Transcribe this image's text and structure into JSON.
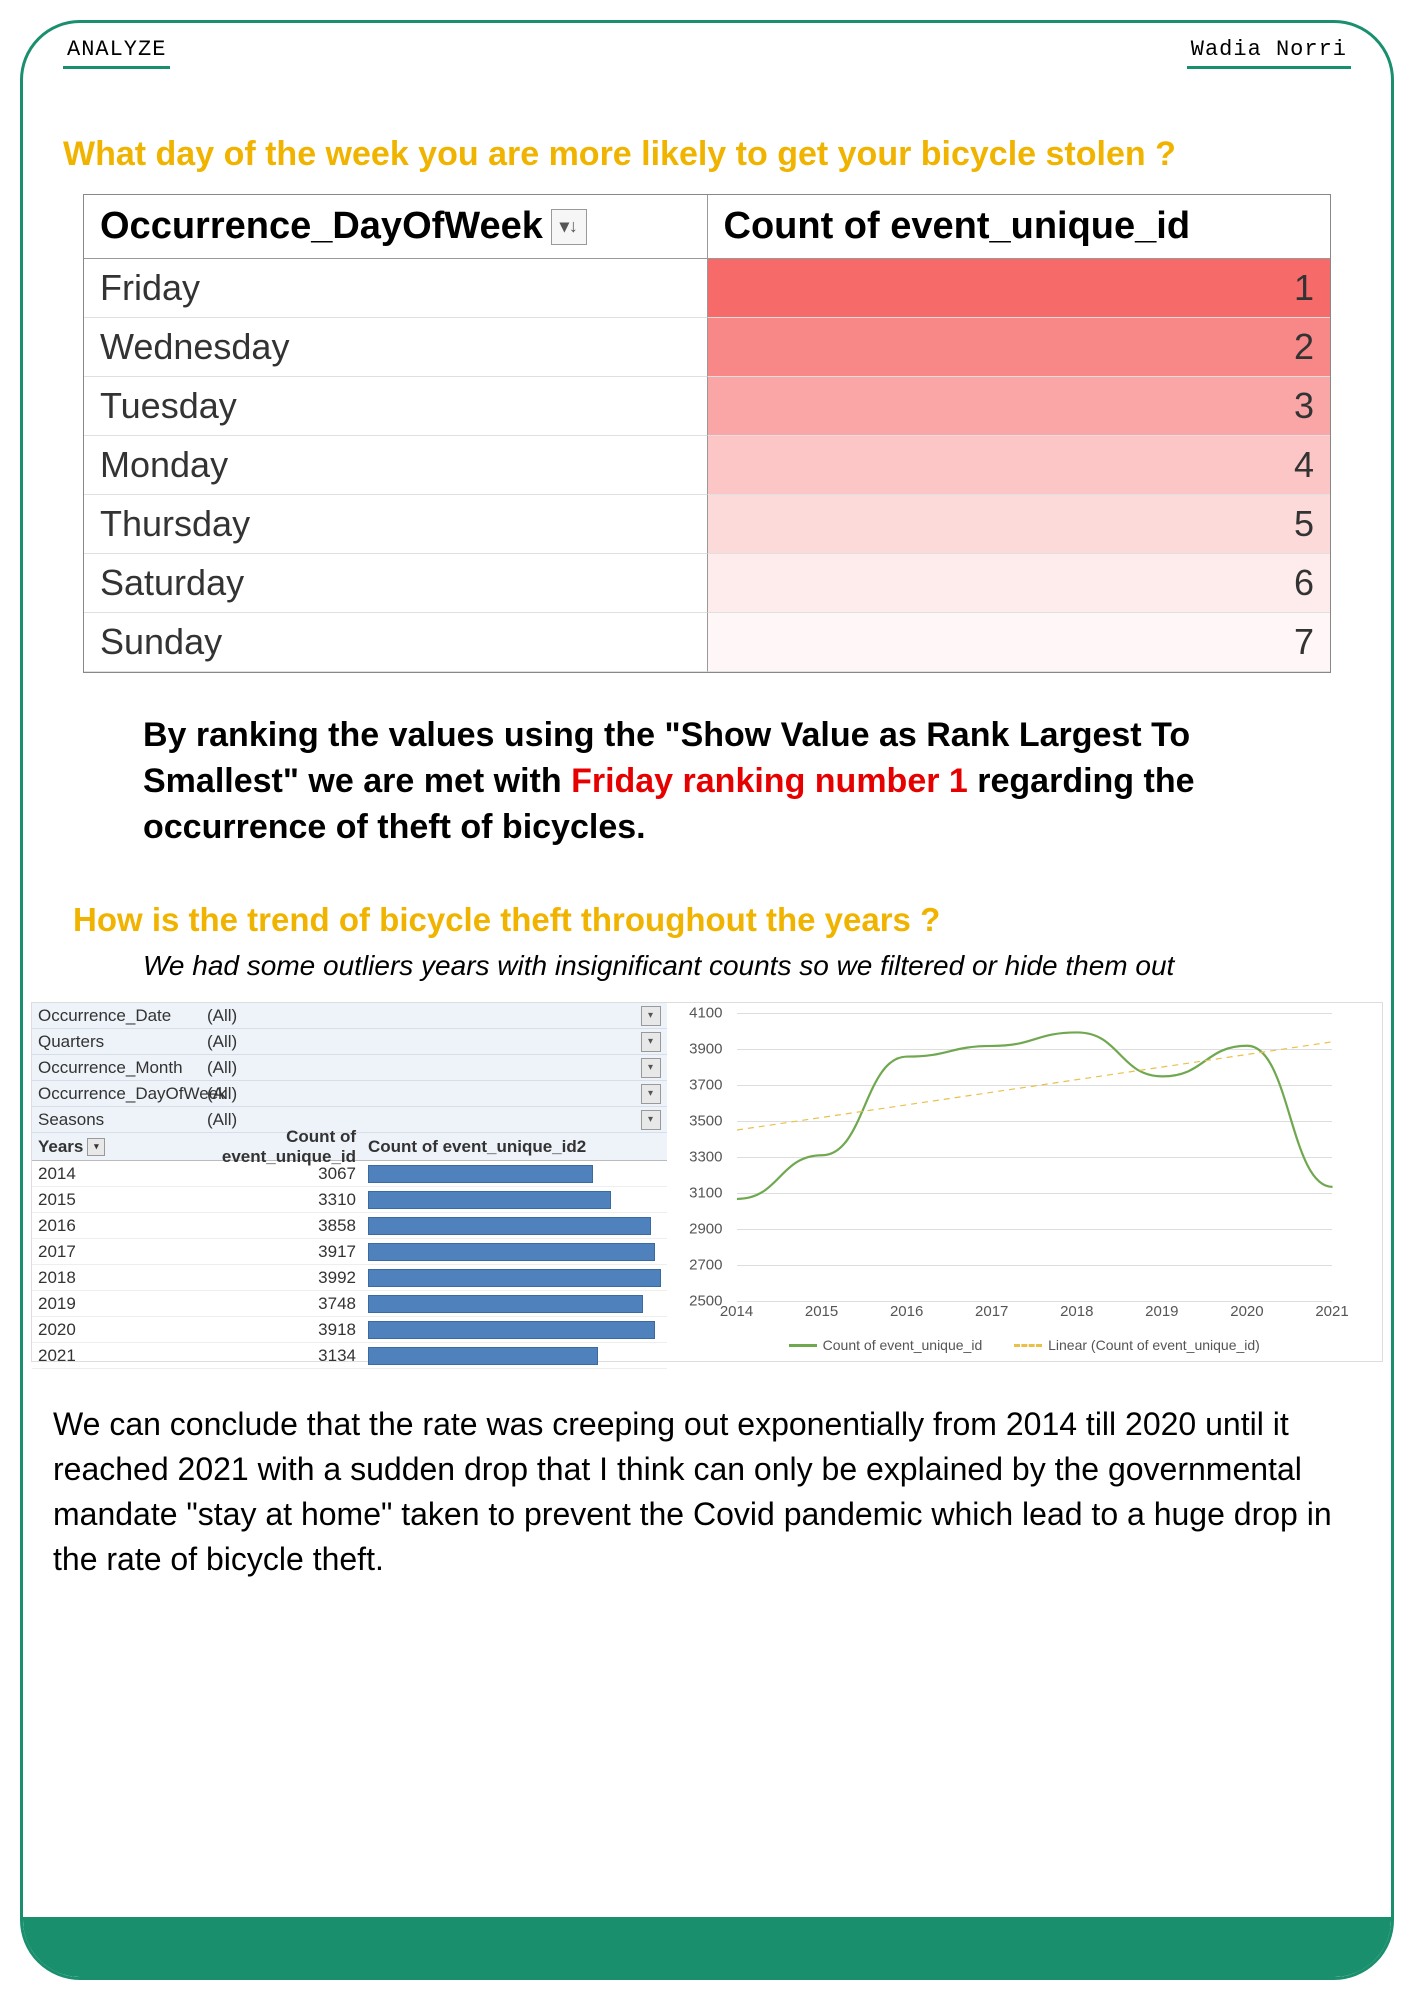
{
  "header": {
    "left": "ANALYZE",
    "right": "Wadia Norri"
  },
  "question1": "What day of the week you are more likely to get your bicycle stolen ?",
  "dow_table": {
    "col_a": "Occurrence_DayOfWeek",
    "col_b": "Count of event_unique_id",
    "rows": [
      {
        "day": "Friday",
        "rank": 1,
        "shade": "#f76a6a"
      },
      {
        "day": "Wednesday",
        "rank": 2,
        "shade": "#f88888"
      },
      {
        "day": "Tuesday",
        "rank": 3,
        "shade": "#faa6a6"
      },
      {
        "day": "Monday",
        "rank": 4,
        "shade": "#fcc6c6"
      },
      {
        "day": "Thursday",
        "rank": 5,
        "shade": "#fddada"
      },
      {
        "day": "Saturday",
        "rank": 6,
        "shade": "#feecec"
      },
      {
        "day": "Sunday",
        "rank": 7,
        "shade": "#fff7f7"
      }
    ]
  },
  "explain1": {
    "pre": "By ranking the values using the \"Show Value as Rank Largest To Smallest\" we  are met with ",
    "red": "Friday ranking number 1",
    "post": " regarding the occurrence of theft of bicycles."
  },
  "question2": "How is the trend of bicycle theft throughout the years ?",
  "note2": "We had some outliers years with insignificant counts so we filtered or hide them out",
  "filters": [
    {
      "name": "Occurrence_Date",
      "value": "(All)"
    },
    {
      "name": "Quarters",
      "value": "(All)"
    },
    {
      "name": "Occurrence_Month",
      "value": "(All)"
    },
    {
      "name": "Occurrence_DayOfWeek",
      "value": "(All)"
    },
    {
      "name": "Seasons",
      "value": "(All)"
    }
  ],
  "year_table": {
    "hdr_years": "Years",
    "hdr_count": "Count of event_unique_id",
    "hdr_count2": "Count of event_unique_id2",
    "rows": [
      {
        "year": "2014",
        "count": 3067
      },
      {
        "year": "2015",
        "count": 3310
      },
      {
        "year": "2016",
        "count": 3858
      },
      {
        "year": "2017",
        "count": 3917
      },
      {
        "year": "2018",
        "count": 3992
      },
      {
        "year": "2019",
        "count": 3748
      },
      {
        "year": "2020",
        "count": 3918
      },
      {
        "year": "2021",
        "count": 3134
      }
    ]
  },
  "chart_data": {
    "type": "line",
    "x": [
      "2014",
      "2015",
      "2016",
      "2017",
      "2018",
      "2019",
      "2020",
      "2021"
    ],
    "series": [
      {
        "name": "Count of event_unique_id",
        "values": [
          3067,
          3310,
          3858,
          3917,
          3992,
          3748,
          3918,
          3134
        ],
        "color": "#6fa84f",
        "style": "solid"
      },
      {
        "name": "Linear (Count of event_unique_id)",
        "values": [
          3450,
          3520,
          3590,
          3660,
          3730,
          3800,
          3870,
          3940
        ],
        "color": "#e8c04a",
        "style": "dashed"
      }
    ],
    "ylim": [
      2500,
      4100
    ],
    "yticks": [
      2500,
      2700,
      2900,
      3100,
      3300,
      3500,
      3700,
      3900,
      4100
    ],
    "xlabel": "",
    "ylabel": ""
  },
  "legend": {
    "s1": "Count of event_unique_id",
    "s2": "Linear (Count of event_unique_id)"
  },
  "conclusion": "We can conclude that the rate was creeping out exponentially from 2014 till 2020 until it reached 2021 with a sudden drop that I think can only be explained by the governmental mandate \"stay at home\" taken to prevent the Covid pandemic which lead to a huge drop in the rate of bicycle theft."
}
